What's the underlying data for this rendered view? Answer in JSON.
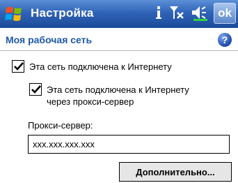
{
  "titlebar": {
    "app_title": "Настройка",
    "ok_label": "ok",
    "icons": [
      "windows-start-icon",
      "connectivity-icon",
      "signal-off-icon",
      "volume-icon"
    ]
  },
  "header": {
    "page_title": "Моя рабочая сеть",
    "help_label": "?"
  },
  "options": {
    "internet": {
      "label": "Эта сеть подключена к Интернету",
      "checked": true
    },
    "via_proxy": {
      "label_line1": "Эта сеть подключена к Интернету",
      "label_line2": "через прокси-сервер",
      "checked": true
    }
  },
  "proxy": {
    "label": "Прокси-сервер:",
    "value": "xxx.xxx.xxx.xxx"
  },
  "advanced_label": "Дополнительно...",
  "colors": {
    "titlebar": "#2f63b8",
    "title_text": "#1f5aa8",
    "accent_green": "#2fd23f"
  }
}
